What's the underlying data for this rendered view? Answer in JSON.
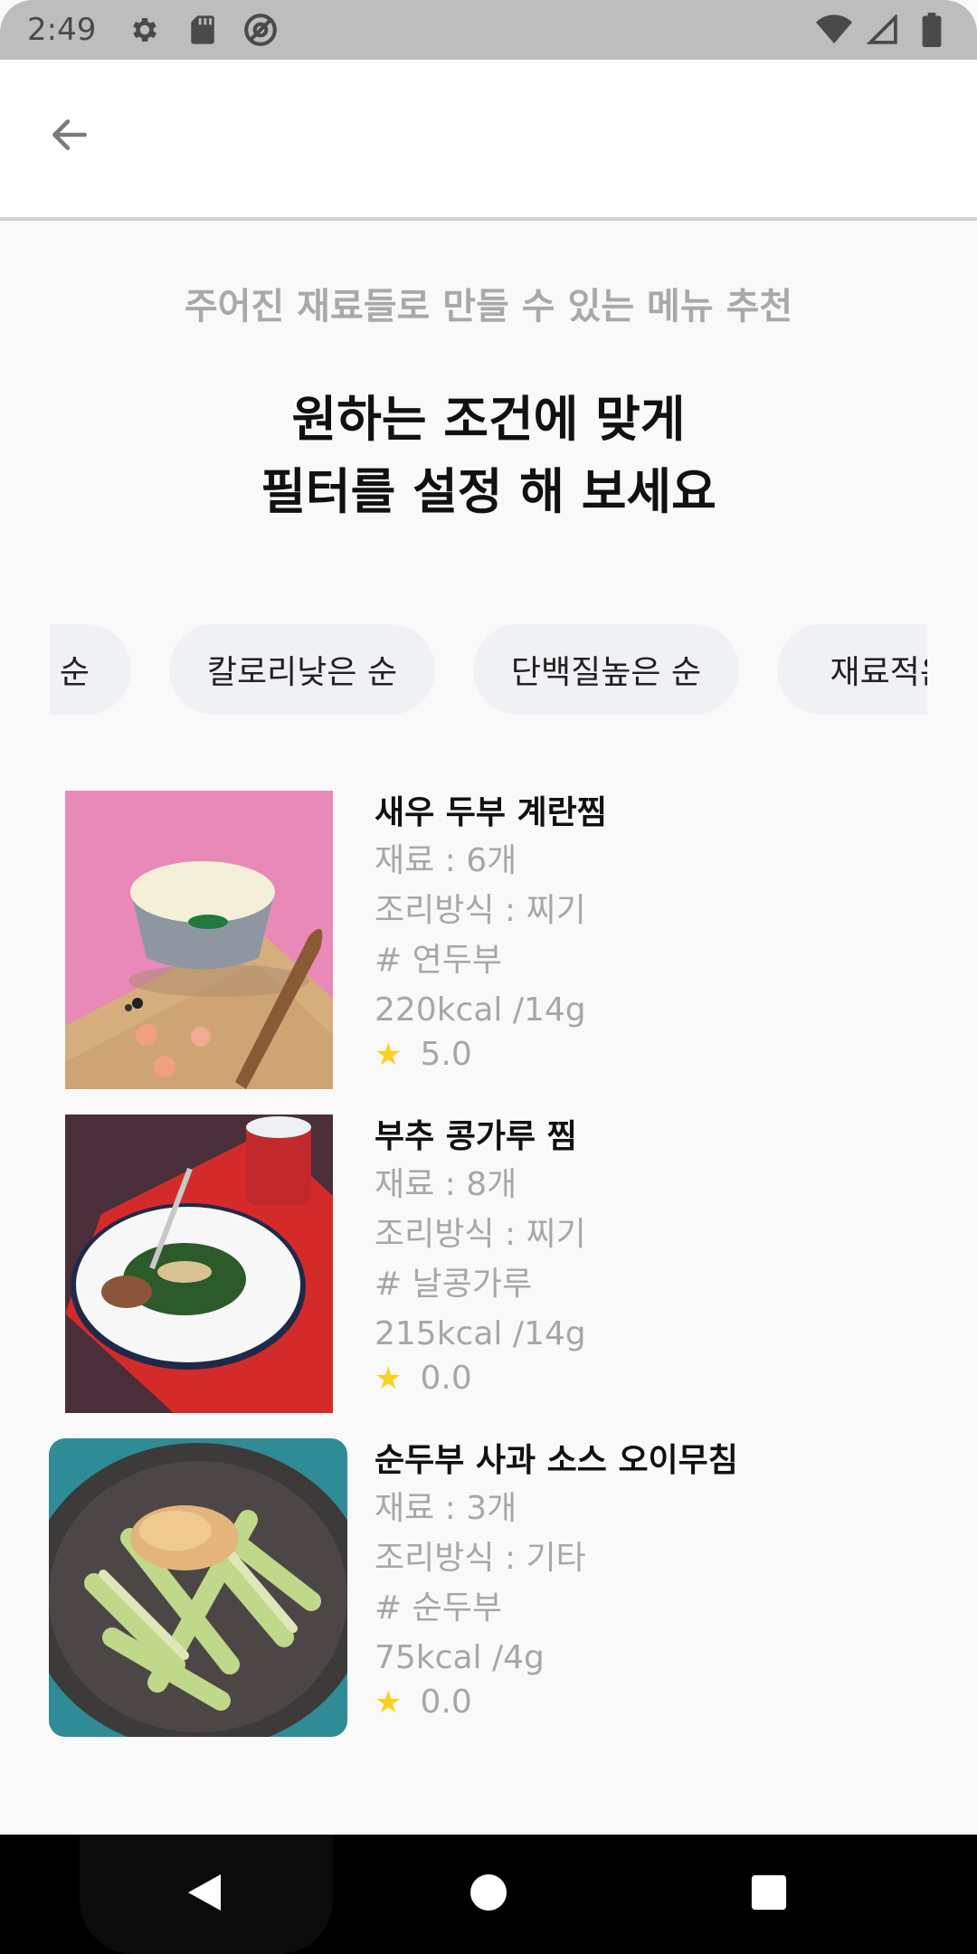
{
  "status_bar": {
    "time": "2:49",
    "left_icons": [
      "settings-icon",
      "sd-card-icon",
      "at-sign-icon"
    ],
    "right_icons": [
      "wifi-icon",
      "cell-signal-icon",
      "battery-icon"
    ]
  },
  "header": {
    "back_icon": "arrow-left-icon"
  },
  "main": {
    "subtitle": "주어진 재료들로 만들 수 있는 메뉴 추천",
    "headline_line1": "원하는 조건에 맞게",
    "headline_line2": "필터를 설정 해 보세요"
  },
  "filters": [
    {
      "label": "순"
    },
    {
      "label": "칼로리낮은 순"
    },
    {
      "label": "단백질높은 순"
    },
    {
      "label": "재료적은 순"
    }
  ],
  "recipes": [
    {
      "title": "새우 두부 계란찜",
      "ingredients": "재료 : 6개",
      "method": "조리방식 : 찌기",
      "tag": "# 연두부",
      "nutrition": "220kcal /14g",
      "rating": "5.0",
      "image_icon": "steamed-egg-dish-image"
    },
    {
      "title": "부추 콩가루 찜",
      "ingredients": "재료 : 8개",
      "method": "조리방식 : 찌기",
      "tag": "# 날콩가루",
      "nutrition": "215kcal /14g",
      "rating": "0.0",
      "image_icon": "chive-dish-image"
    },
    {
      "title": "순두부 사과 소스 오이무침",
      "ingredients": "재료 : 3개",
      "method": "조리방식 : 기타",
      "tag": "# 순두부",
      "nutrition": "75kcal /4g",
      "rating": "0.0",
      "image_icon": "cucumber-salad-image"
    }
  ],
  "nav": {
    "back": "back-triangle-icon",
    "home": "home-circle-icon",
    "recents": "recents-square-icon"
  },
  "colors": {
    "star": "#f7d21e",
    "chip_bg": "#f0f1f4",
    "muted_text": "#a7a7a7"
  }
}
